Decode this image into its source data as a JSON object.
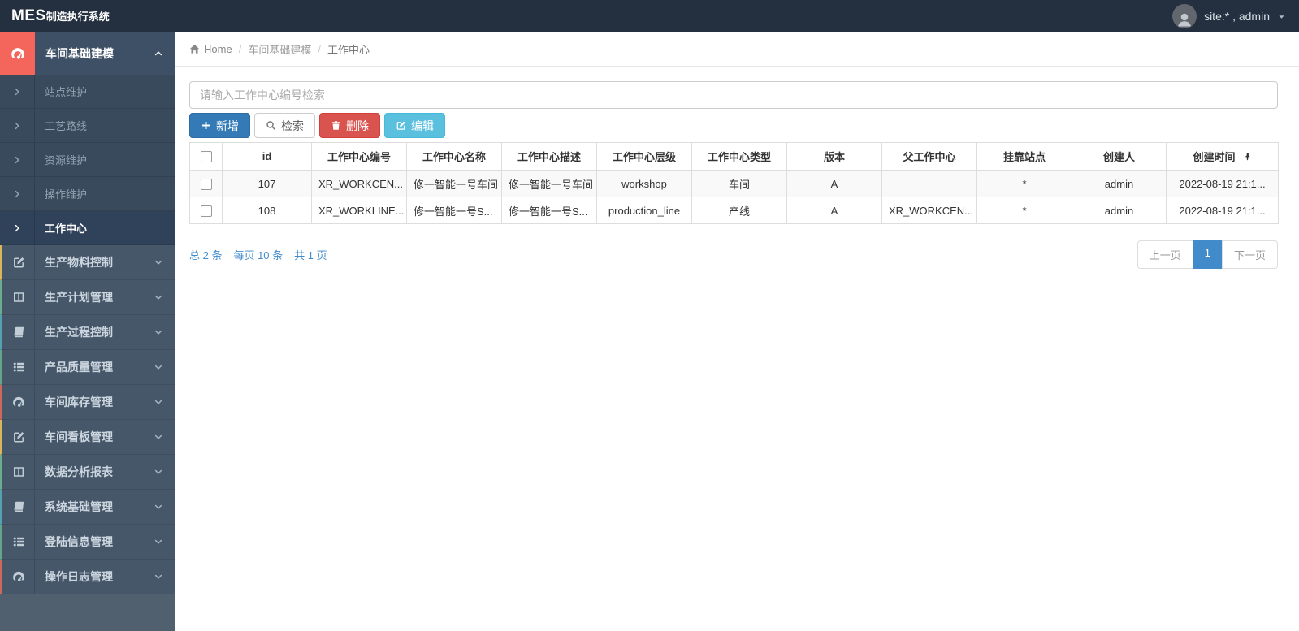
{
  "topbar": {
    "logo_primary": "MES",
    "logo_secondary": "制造执行系统",
    "user_label": "site:* , admin"
  },
  "breadcrumb": {
    "home": "Home",
    "level1": "车间基础建模",
    "level2": "工作中心",
    "separator": "/"
  },
  "sidebar": {
    "active_parent": {
      "label": "车间基础建模",
      "icon": "gauge-icon",
      "accent": "#f4665c"
    },
    "submenu": [
      {
        "label": "站点维护"
      },
      {
        "label": "工艺路线"
      },
      {
        "label": "资源维护"
      },
      {
        "label": "操作维护"
      },
      {
        "label": "工作中心",
        "active": true
      }
    ],
    "parents": [
      {
        "label": "生产物料控制",
        "icon": "pencil-square-icon",
        "accent": "#d9b65c"
      },
      {
        "label": "生产计划管理",
        "icon": "columns-icon",
        "accent": "#6aae8d"
      },
      {
        "label": "生产过程控制",
        "icon": "book-icon",
        "accent": "#57a0b2"
      },
      {
        "label": "产品质量管理",
        "icon": "list-icon",
        "accent": "#64a788"
      },
      {
        "label": "车间库存管理",
        "icon": "gauge-icon",
        "accent": "#cf685c"
      },
      {
        "label": "车间看板管理",
        "icon": "pencil-square-icon",
        "accent": "#d9b65c"
      },
      {
        "label": "数据分析报表",
        "icon": "columns-icon",
        "accent": "#6aae8d"
      },
      {
        "label": "系统基础管理",
        "icon": "book-icon",
        "accent": "#57a0b2"
      },
      {
        "label": "登陆信息管理",
        "icon": "list-icon",
        "accent": "#64a788"
      },
      {
        "label": "操作日志管理",
        "icon": "gauge-icon",
        "accent": "#cf685c"
      }
    ]
  },
  "search": {
    "placeholder": "请输入工作中心编号检索",
    "value": ""
  },
  "toolbar": {
    "add": "新增",
    "search": "检索",
    "delete": "删除",
    "edit": "编辑"
  },
  "table": {
    "columns": [
      "id",
      "工作中心编号",
      "工作中心名称",
      "工作中心描述",
      "工作中心层级",
      "工作中心类型",
      "版本",
      "父工作中心",
      "挂靠站点",
      "创建人",
      "创建时间"
    ],
    "rows": [
      {
        "cells": [
          "107",
          "XR_WORKCEN...",
          "修一智能一号车间",
          "修一智能一号车间",
          "workshop",
          "车间",
          "A",
          "",
          "*",
          "admin",
          "2022-08-19 21:1..."
        ]
      },
      {
        "cells": [
          "108",
          "XR_WORKLINE...",
          "修一智能一号S...",
          "修一智能一号S...",
          "production_line",
          "产线",
          "A",
          "XR_WORKCEN...",
          "*",
          "admin",
          "2022-08-19 21:1..."
        ]
      }
    ]
  },
  "pagination": {
    "total": "总 2 条",
    "per_page": "每页 10 条",
    "pages": "共 1 页",
    "prev": "上一页",
    "current": "1",
    "next": "下一页"
  },
  "colors": {
    "primary": "#337ab7",
    "danger": "#d9534f",
    "info": "#5bc0de",
    "link": "#428bca",
    "sidebar_accent_red": "#f4665c"
  }
}
